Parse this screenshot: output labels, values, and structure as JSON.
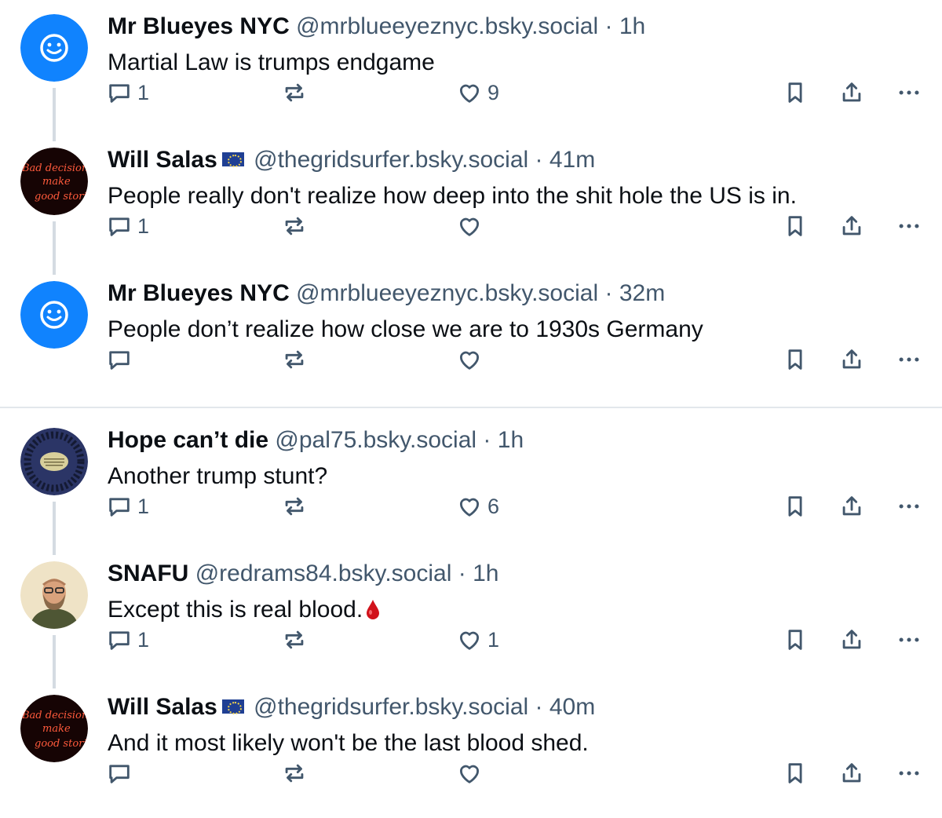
{
  "posts": [
    {
      "author": "Mr Blueyes NYC",
      "flag": false,
      "handle": "@mrblueeyeznyc.bsky.social",
      "time": "1h",
      "text": "Martial Law is trumps endgame",
      "replies": "1",
      "likes": "9",
      "avatar": "smiley-default-avatar"
    },
    {
      "author": "Will Salas",
      "flag": true,
      "handle": "@thegridsurfer.bsky.social",
      "time": "41m",
      "text": "People really don't realize how deep into the shit hole the US is in.",
      "replies": "1",
      "likes": "",
      "avatar": "neon-sign-avatar",
      "avatar_text": [
        "Bad decisions",
        "make",
        "good stories"
      ]
    },
    {
      "author": "Mr Blueyes NYC",
      "flag": false,
      "handle": "@mrblueeyeznyc.bsky.social",
      "time": "32m",
      "text": "People don’t realize how close we are to 1930s Germany",
      "replies": "",
      "likes": "",
      "avatar": "smiley-default-avatar"
    },
    {
      "author": "Hope can’t die",
      "flag": false,
      "handle": "@pal75.bsky.social",
      "time": "1h",
      "text": "Another trump stunt?",
      "replies": "1",
      "likes": "6",
      "avatar": "group-circle-avatar"
    },
    {
      "author": "SNAFU",
      "flag": false,
      "handle": "@redrams84.bsky.social",
      "time": "1h",
      "text": "Except this is real blood.",
      "replies": "1",
      "likes": "1",
      "avatar": "portrait-avatar",
      "emoji": "drop-of-blood-icon"
    },
    {
      "author": "Will Salas",
      "flag": true,
      "handle": "@thegridsurfer.bsky.social",
      "time": "40m",
      "text": "And it most likely won't be the last blood shed.",
      "replies": "",
      "likes": "",
      "avatar": "neon-sign-avatar",
      "avatar_text": [
        "Bad decisions",
        "make",
        "good stories"
      ]
    }
  ],
  "separator": "·",
  "colors": {
    "accent": "#1083fe",
    "muted": "#42576c",
    "text": "#0b0f14",
    "thread_line": "#d4dbe2"
  },
  "icons": {
    "reply": "reply-bubble-icon",
    "repost": "repost-arrows-icon",
    "like": "heart-icon",
    "save": "bookmark-icon",
    "share": "share-icon",
    "more": "more-dots-icon"
  }
}
